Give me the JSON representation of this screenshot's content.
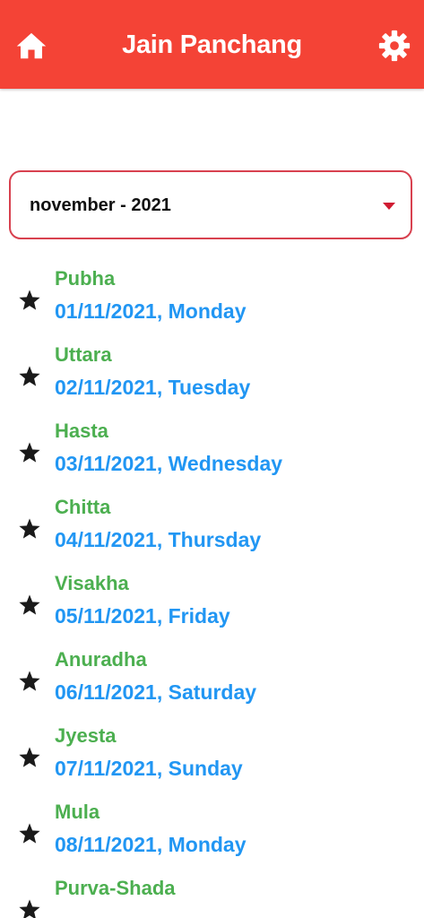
{
  "header": {
    "title": "Jain Panchang",
    "home_icon": "home-icon",
    "settings_icon": "gear-icon",
    "background_color": "#f44336"
  },
  "month_selector": {
    "selected": "november - 2021",
    "border_color": "#d8414f",
    "caret_color": "#d01c32"
  },
  "colors": {
    "nakshatra_text": "#4caf50",
    "date_text": "#2196f3",
    "star_icon": "#1a1a1a"
  },
  "entries": [
    {
      "nakshatra": "Pubha",
      "date": "01/11/2021, Monday",
      "icon": "star-icon"
    },
    {
      "nakshatra": "Uttara",
      "date": "02/11/2021, Tuesday",
      "icon": "star-icon"
    },
    {
      "nakshatra": "Hasta",
      "date": "03/11/2021, Wednesday",
      "icon": "star-icon"
    },
    {
      "nakshatra": "Chitta",
      "date": "04/11/2021, Thursday",
      "icon": "star-icon"
    },
    {
      "nakshatra": "Visakha",
      "date": "05/11/2021, Friday",
      "icon": "star-icon"
    },
    {
      "nakshatra": "Anuradha",
      "date": "06/11/2021, Saturday",
      "icon": "star-icon"
    },
    {
      "nakshatra": "Jyesta",
      "date": "07/11/2021, Sunday",
      "icon": "star-icon"
    },
    {
      "nakshatra": "Mula",
      "date": "08/11/2021, Monday",
      "icon": "star-icon"
    },
    {
      "nakshatra": "Purva-Shada",
      "date": "",
      "icon": "star-icon"
    }
  ]
}
